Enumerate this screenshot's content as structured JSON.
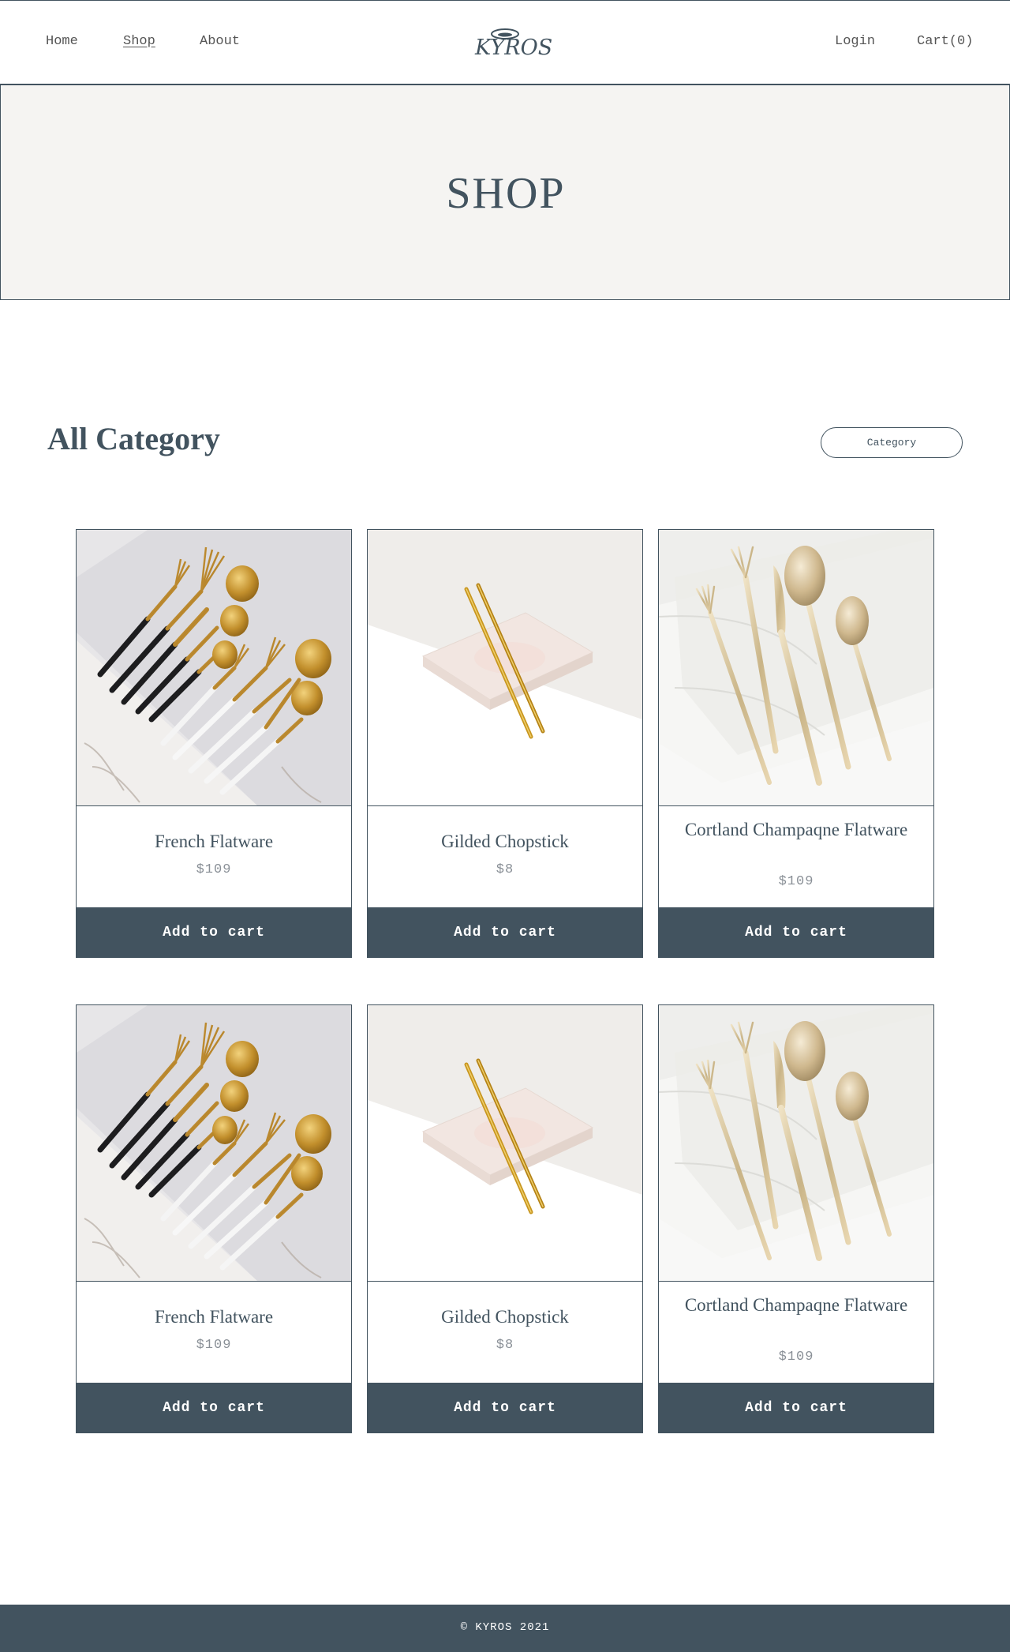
{
  "nav": {
    "home": "Home",
    "shop": "Shop",
    "about": "About",
    "login": "Login",
    "cart": "Cart(0)",
    "logo_text": "KYROS"
  },
  "hero": {
    "title": "SHOP"
  },
  "section": {
    "title": "All Category",
    "category_button": "Category"
  },
  "products": [
    {
      "name": "French Flatware",
      "price": "$109",
      "button": "Add to cart",
      "image": "french-flatware-image"
    },
    {
      "name": "Gilded Chopstick",
      "price": "$8",
      "button": "Add to cart",
      "image": "gilded-chopstick-image"
    },
    {
      "name": "Cortland Champaqne Flatware",
      "price": "$109",
      "button": "Add to cart",
      "image": "champagne-flatware-image"
    },
    {
      "name": "French Flatware",
      "price": "$109",
      "button": "Add to cart",
      "image": "french-flatware-image"
    },
    {
      "name": "Gilded Chopstick",
      "price": "$8",
      "button": "Add to cart",
      "image": "gilded-chopstick-image"
    },
    {
      "name": "Cortland Champaqne Flatware",
      "price": "$109",
      "button": "Add to cart",
      "image": "champagne-flatware-image"
    }
  ],
  "footer": {
    "text": "© KYROS 2021"
  },
  "colors": {
    "primary": "#42535f",
    "hero_bg": "#f5f4f2",
    "gold": "#c9a24a"
  }
}
